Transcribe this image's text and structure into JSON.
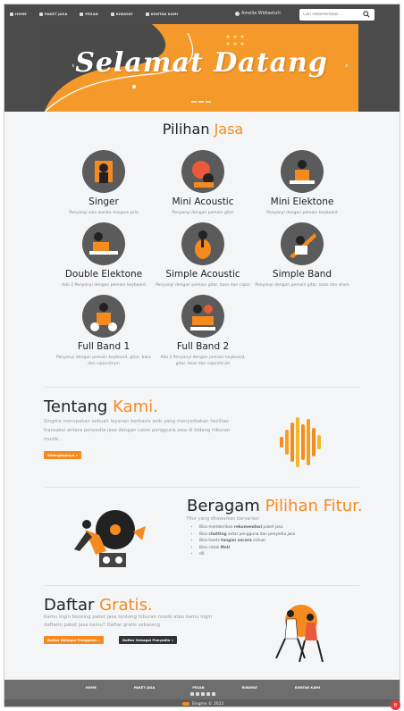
{
  "nav": {
    "items": [
      {
        "label": "HOME",
        "icon": "home-icon"
      },
      {
        "label": "PAKET JASA",
        "icon": "package-icon"
      },
      {
        "label": "PESAN",
        "icon": "cart-icon"
      },
      {
        "label": "RIWAYAT",
        "icon": "history-icon"
      },
      {
        "label": "KONTAK KAMI",
        "icon": "contact-icon"
      }
    ],
    "user": "Amelia Widiastuti",
    "search_placeholder": "Cari rekomendasi..."
  },
  "hero": {
    "title": "Selamat Datang",
    "prev": "‹",
    "next": "›"
  },
  "services": {
    "title_main": "Pilihan ",
    "title_accent": "Jasa",
    "items": [
      {
        "name": "Singer",
        "desc": "Penyanyi solo wanita maupun pria"
      },
      {
        "name": "Mini Acoustic",
        "desc": "Penyanyi dengan pemain gitar"
      },
      {
        "name": "Mini Elektone",
        "desc": "Penyanyi dengan pemain keyboard"
      },
      {
        "name": "Double Elektone",
        "desc": "Ada 2 Penyanyi dengan pemain keyboard"
      },
      {
        "name": "Simple Acoustic",
        "desc": "Penyanyi dengan pemain gitar, bass dan cajon"
      },
      {
        "name": "Simple Band",
        "desc": "Penyanyi dengan pemain gitar, bass dan drum"
      },
      {
        "name": "Full Band 1",
        "desc": "Penyanyi dengan pemain keyboard, gitar, bass dan cajon/drum"
      },
      {
        "name": "Full Band 2",
        "desc": "Ada 2 Penyanyi dengan pemain keyboard, gitar, bass dan cajon/drum"
      }
    ]
  },
  "about": {
    "title_main": "Tentang ",
    "title_accent": "Kami.",
    "text": "Singme merupakan sebuah layanan berbasis web yang menyediakan fasilitas transaksi antara penyedia jasa dengan calon pengguna jasa di bidang hiburan musik...",
    "button": "Selengkapnya »"
  },
  "features": {
    "title_main": "Beragam ",
    "title_accent": "Pilihan Fitur.",
    "subtitle": "Fitur yang ditawarkan bervariasi",
    "list": [
      [
        "Bisa memberikan ",
        "rekomendasi",
        " paket jasa"
      ],
      [
        "Bisa ",
        "chatting",
        " antar pengguna dan penyedia jasa"
      ],
      [
        "Bisa tanda ",
        "tangan secara",
        " virtual"
      ],
      [
        "Bisa cetak ",
        "MoU",
        ""
      ],
      [
        "dll.",
        "",
        ""
      ]
    ]
  },
  "register": {
    "title_main": "Daftar ",
    "title_accent": "Gratis.",
    "text": "Kamu ingin booking paket jasa tentang hiburan musik atau kamu ingin daftarin paket jasa kamu? Daftar gratis sekarang",
    "btn_user": "Daftar Sebagai Pengguna »",
    "btn_provider": "Daftar Sebagai Penyedia »"
  },
  "footer": {
    "links": [
      "HOME",
      "PAKET JASA",
      "PESAN",
      "RIWAYAT",
      "KONTAK KAMI"
    ],
    "social": [
      "facebook-icon",
      "youtube-icon",
      "instagram-icon",
      "mail-icon",
      "github-icon"
    ],
    "copyright": "Singme © 2022"
  },
  "chat_badge": "8",
  "colors": {
    "accent": "#f58a1f",
    "nav": "#4b4b4b",
    "footer": "#6e6e6e"
  }
}
